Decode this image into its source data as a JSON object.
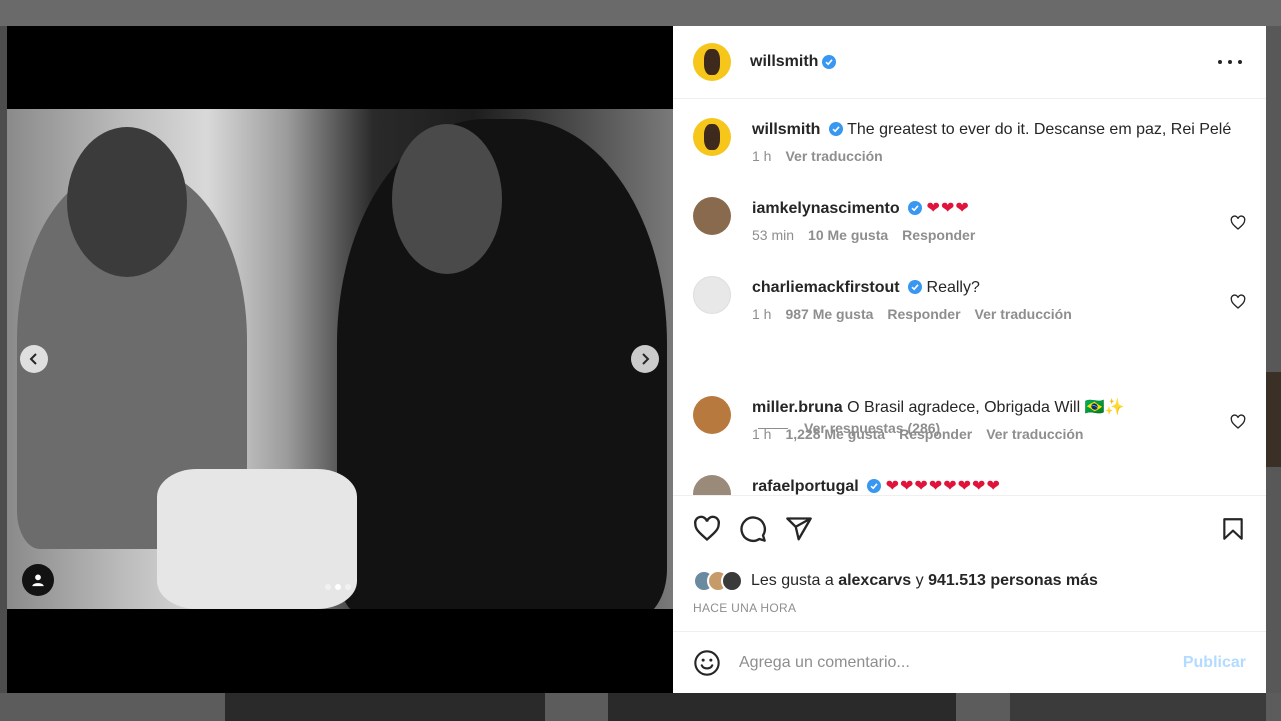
{
  "colors": {
    "accent": "#0095f6",
    "verified": "#3897f0",
    "heart": "#e0133b",
    "publish_disabled": "#b3dbff"
  },
  "header": {
    "username": "willsmith"
  },
  "post": {
    "username": "willsmith",
    "caption": "The greatest to ever do it. Descanse em paz, Rei Pelé",
    "time": "1 h",
    "translate": "Ver traducción"
  },
  "comments": [
    {
      "username": "iamkelynascimento",
      "text": "❤❤❤",
      "time": "53 min",
      "likes": "10 Me gusta",
      "reply": "Responder",
      "translate": ""
    },
    {
      "username": "charliemackfirstout",
      "text": "Really?",
      "time": "1 h",
      "likes": "987 Me gusta",
      "reply": "Responder",
      "translate": "Ver traducción"
    },
    {
      "username": "miller.bruna",
      "text": "O Brasil agradece, Obrigada Will 🇧🇷✨",
      "time": "1 h",
      "likes": "1,228 Me gusta",
      "reply": "Responder",
      "translate": "Ver traducción"
    },
    {
      "username": "rafaelportugal",
      "text": "❤❤❤❤❤❤❤❤"
    }
  ],
  "replies": {
    "label": "Ver respuestas (286)"
  },
  "likes": {
    "prefix": "Les gusta a",
    "user": "alexcarvs",
    "joiner": "y",
    "count": "941.513 personas más"
  },
  "timestamp": "HACE UNA HORA",
  "add_comment": {
    "placeholder": "Agrega un comentario...",
    "publish": "Publicar"
  },
  "carousel": {
    "total": 3,
    "active": 2
  }
}
